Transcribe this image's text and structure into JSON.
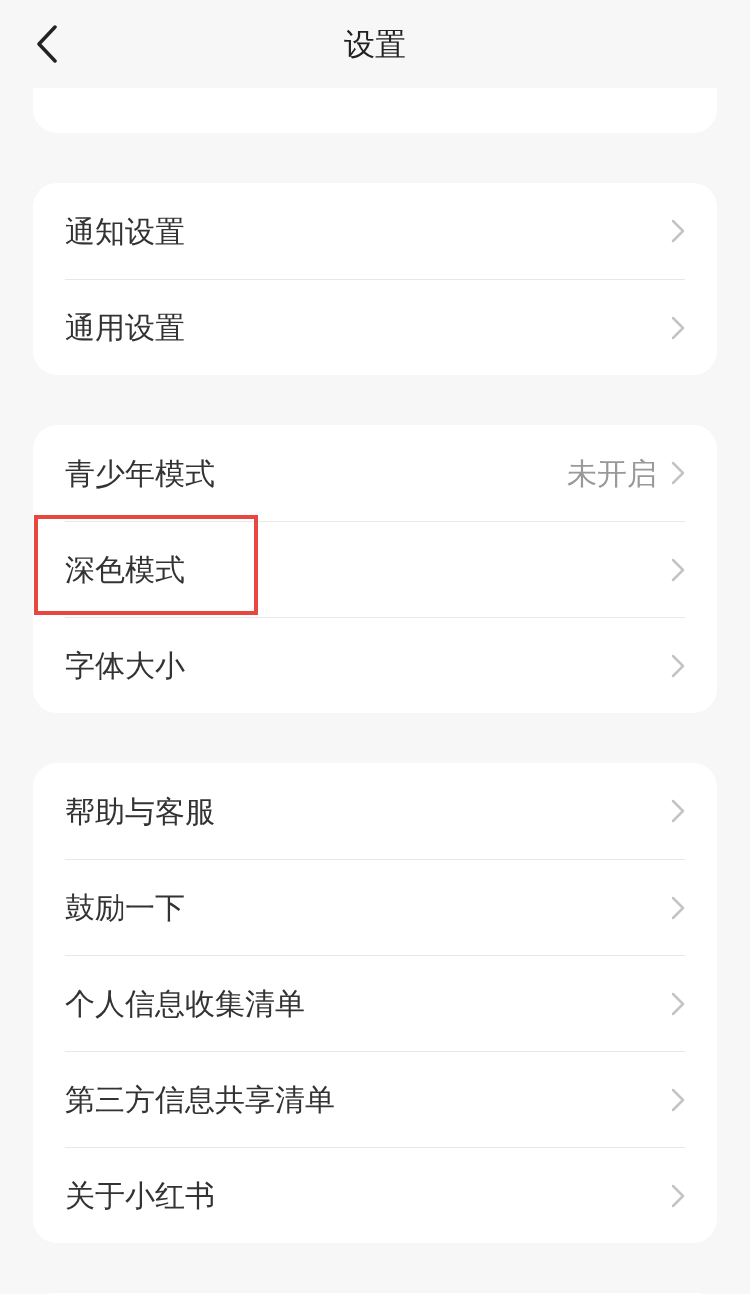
{
  "header": {
    "title": "设置"
  },
  "groups": [
    {
      "kind": "partial"
    },
    {
      "items": [
        {
          "label": "通知设置",
          "highlighted": false
        },
        {
          "label": "通用设置",
          "highlighted": false
        }
      ]
    },
    {
      "items": [
        {
          "label": "青少年模式",
          "value": "未开启",
          "highlighted": false
        },
        {
          "label": "深色模式",
          "highlighted": true
        },
        {
          "label": "字体大小",
          "highlighted": false
        }
      ]
    },
    {
      "items": [
        {
          "label": "帮助与客服",
          "highlighted": false
        },
        {
          "label": "鼓励一下",
          "highlighted": false
        },
        {
          "label": "个人信息收集清单",
          "highlighted": false
        },
        {
          "label": "第三方信息共享清单",
          "highlighted": false
        },
        {
          "label": "关于小红书",
          "highlighted": false
        }
      ]
    },
    {
      "kind": "partial"
    }
  ]
}
